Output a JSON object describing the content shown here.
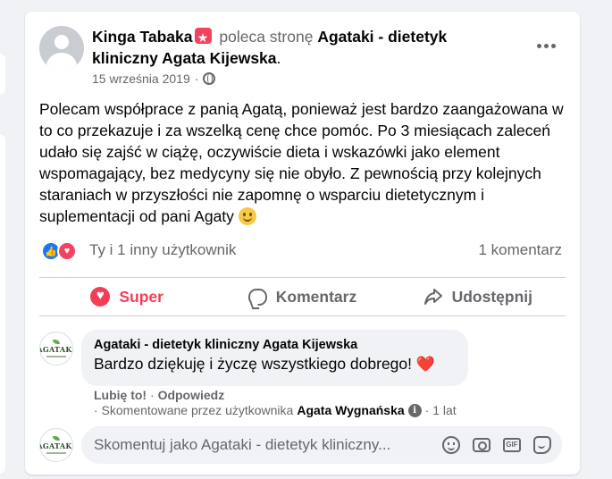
{
  "post": {
    "author": "Kinga Tabaka",
    "recommends_text": "poleca stronę",
    "page_name": "Agataki - dietetyk kliniczny Agata Kijewska",
    "period": ".",
    "date": "15 września 2019",
    "date_sep": "·",
    "privacy_icon": "globe-icon",
    "body": "Polecam współprace z panią Agatą, ponieważ jest bardzo zaangażowana w to co przekazuje i za wszelką cenę chce pomóc. Po 3 miesiącach zaleceń udało się zajść w ciążę, oczywiście dieta i wskazówki jako element wspomagający, bez medycyny się nie obyło. Z pewnością przy kolejnych staraniach w przyszłości nie zapomnę o wsparciu dietetycznym i suplementacji od pani Agaty"
  },
  "reactions": {
    "summary": "Ty i 1 inny użytkownik",
    "comments_count": "1 komentarz"
  },
  "actions": {
    "react": "Super",
    "comment": "Komentarz",
    "share": "Udostępnij"
  },
  "comment": {
    "author": "Agataki - dietetyk kliniczny Agata Kijewska",
    "text": "Bardzo dziękuję i życzę wszystkiego dobrego!",
    "emoji": "❤️",
    "like_label": "Lubię to!",
    "sep": "·",
    "reply_label": "Odpowiedz",
    "meta_prefix": "· Skomentowane przez użytkownika",
    "meta_user": "Agata Wygnańska",
    "meta_time": "· 1 lat"
  },
  "composer": {
    "placeholder": "Skomentuj jako Agataki - dietetyk kliniczny..."
  },
  "colors": {
    "accent_love": "#f33e58",
    "like_blue": "#1877f2",
    "secondary_text": "#65676b"
  }
}
